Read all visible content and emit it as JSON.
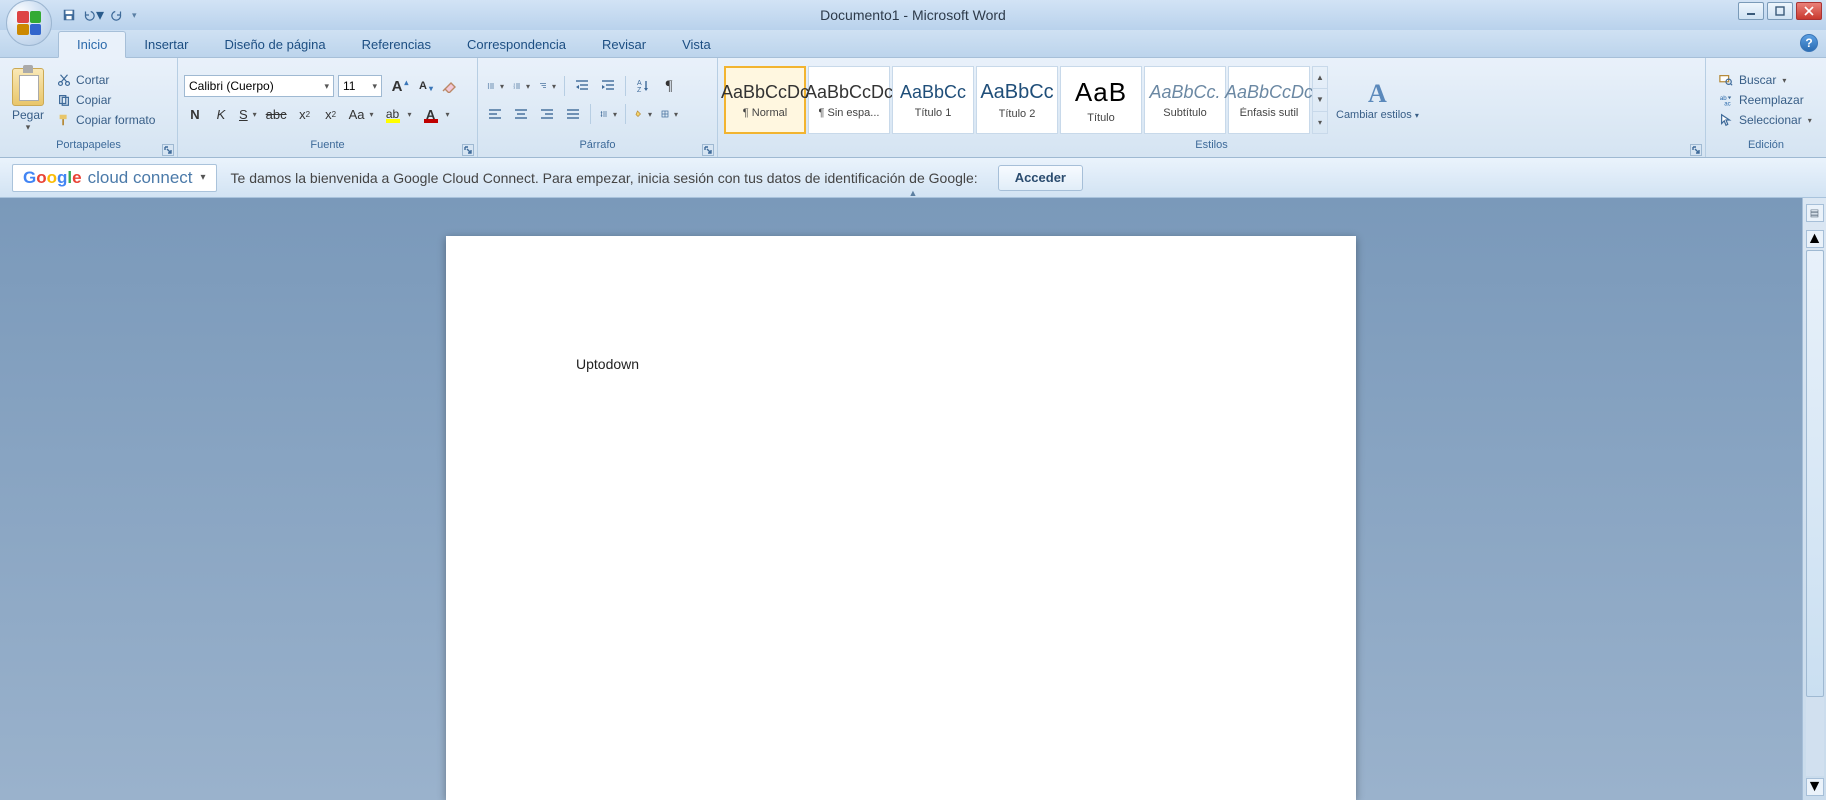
{
  "window": {
    "title": "Documento1 - Microsoft Word"
  },
  "tabs": {
    "inicio": "Inicio",
    "insertar": "Insertar",
    "diseno": "Diseño de página",
    "referencias": "Referencias",
    "correspondencia": "Correspondencia",
    "revisar": "Revisar",
    "vista": "Vista"
  },
  "clipboard": {
    "paste": "Pegar",
    "cut": "Cortar",
    "copy": "Copiar",
    "format_painter": "Copiar formato",
    "group": "Portapapeles"
  },
  "font": {
    "family": "Calibri (Cuerpo)",
    "size": "11",
    "group": "Fuente"
  },
  "paragraph": {
    "group": "Párrafo"
  },
  "styles": {
    "items": [
      {
        "preview": "AaBbCcDc",
        "label": "¶ Normal",
        "cls": ""
      },
      {
        "preview": "AaBbCcDc",
        "label": "¶ Sin espa...",
        "cls": ""
      },
      {
        "preview": "AaBbCc",
        "label": "Título 1",
        "cls": "sp-blue"
      },
      {
        "preview": "AaBbCc",
        "label": "Título 2",
        "cls": "sp-bigblue"
      },
      {
        "preview": "AaB",
        "label": "Título",
        "cls": "sp-title"
      },
      {
        "preview": "AaBbCc.",
        "label": "Subtítulo",
        "cls": "sp-sub"
      },
      {
        "preview": "AaBbCcDc",
        "label": "Énfasis sutil",
        "cls": "sp-emph"
      }
    ],
    "change": "Cambiar estilos",
    "group": "Estilos"
  },
  "editing": {
    "find": "Buscar",
    "replace": "Reemplazar",
    "select": "Seleccionar",
    "group": "Edición"
  },
  "gcc": {
    "logo_cloud": "cloud connect",
    "message": "Te damos la bienvenida a Google Cloud Connect. Para empezar, inicia sesión con tus datos de identificación de Google:",
    "login": "Acceder"
  },
  "document": {
    "content": "Uptodown"
  }
}
